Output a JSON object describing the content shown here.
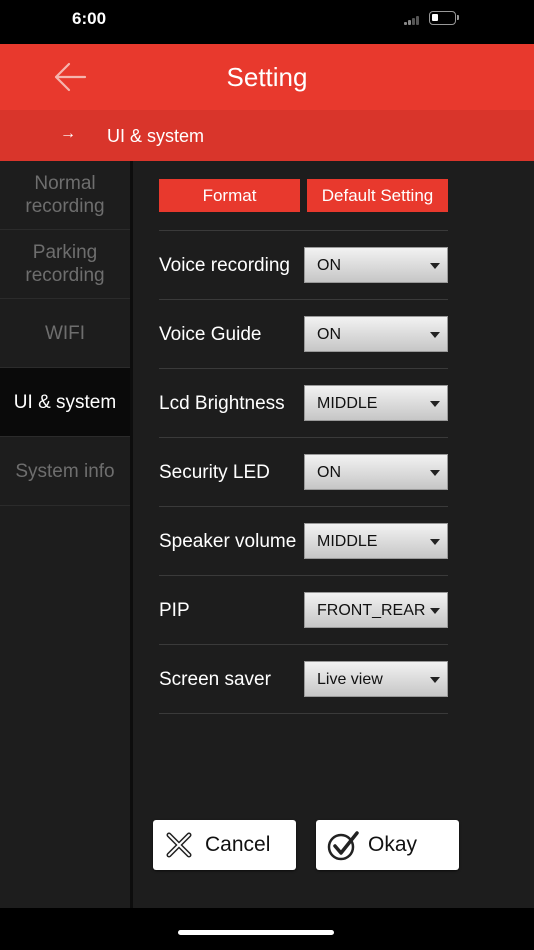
{
  "status_bar": {
    "time": "6:00"
  },
  "header": {
    "title": "Setting",
    "back_icon": "arrow-left-icon"
  },
  "breadcrumb": {
    "arrow": "→",
    "text": "UI &  system"
  },
  "sidebar": {
    "items": [
      {
        "label": "Normal recording",
        "active": false
      },
      {
        "label": "Parking recording",
        "active": false
      },
      {
        "label": "WIFI",
        "active": false
      },
      {
        "label": "UI & system",
        "active": true
      },
      {
        "label": "System info",
        "active": false
      }
    ]
  },
  "buttons": {
    "format": "Format",
    "default_setting": "Default Setting"
  },
  "settings": [
    {
      "label": "Voice recording",
      "value": "ON"
    },
    {
      "label": "Voice Guide",
      "value": "ON"
    },
    {
      "label": "Lcd Brightness",
      "value": "MIDDLE"
    },
    {
      "label": "Security LED",
      "value": "ON"
    },
    {
      "label": "Speaker volume",
      "value": "MIDDLE"
    },
    {
      "label": "PIP",
      "value": "FRONT_REAR"
    },
    {
      "label": "Screen saver",
      "value": "Live view"
    }
  ],
  "actions": {
    "cancel": "Cancel",
    "okay": "Okay"
  },
  "colors": {
    "accent": "#e8392d",
    "breadcrumb": "#d9352b",
    "panel": "#1d1d1d",
    "active_item": "#0a0a0a"
  }
}
